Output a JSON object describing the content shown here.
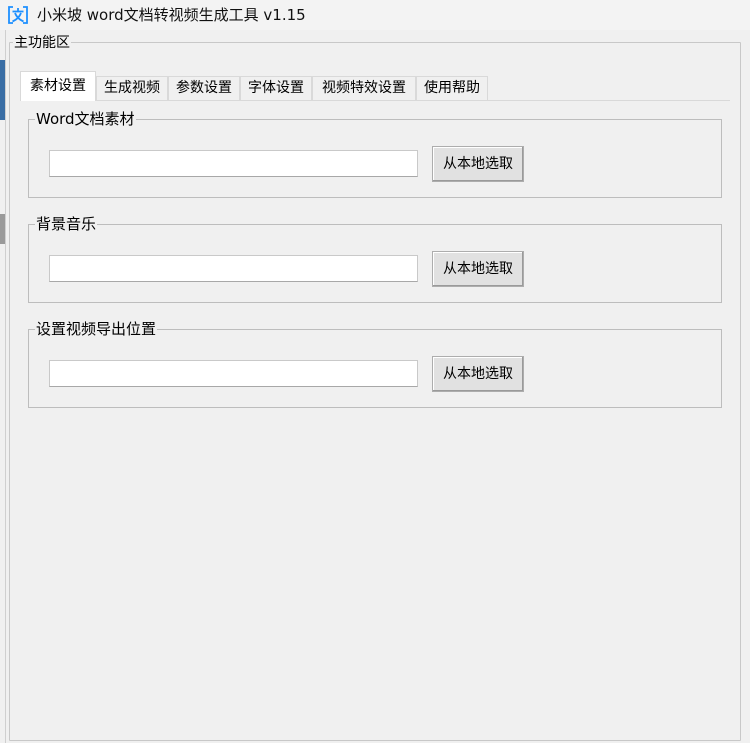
{
  "window": {
    "title": "小米坡 word文档转视频生成工具 v1.15",
    "icon": "app-text-icon",
    "icon_color": "#1e90ff"
  },
  "main_group": {
    "label": "主功能区"
  },
  "tabs": [
    {
      "label": "素材设置",
      "active": true
    },
    {
      "label": "生成视频",
      "active": false
    },
    {
      "label": "参数设置",
      "active": false
    },
    {
      "label": "字体设置",
      "active": false
    },
    {
      "label": "视频特效设置",
      "active": false
    },
    {
      "label": "使用帮助",
      "active": false
    }
  ],
  "sections": {
    "word_material": {
      "label": "Word文档素材",
      "input_value": "",
      "button_label": "从本地选取"
    },
    "background_music": {
      "label": "背景音乐",
      "input_value": "",
      "button_label": "从本地选取"
    },
    "export_location": {
      "label": "设置视频导出位置",
      "input_value": "",
      "button_label": "从本地选取"
    }
  }
}
